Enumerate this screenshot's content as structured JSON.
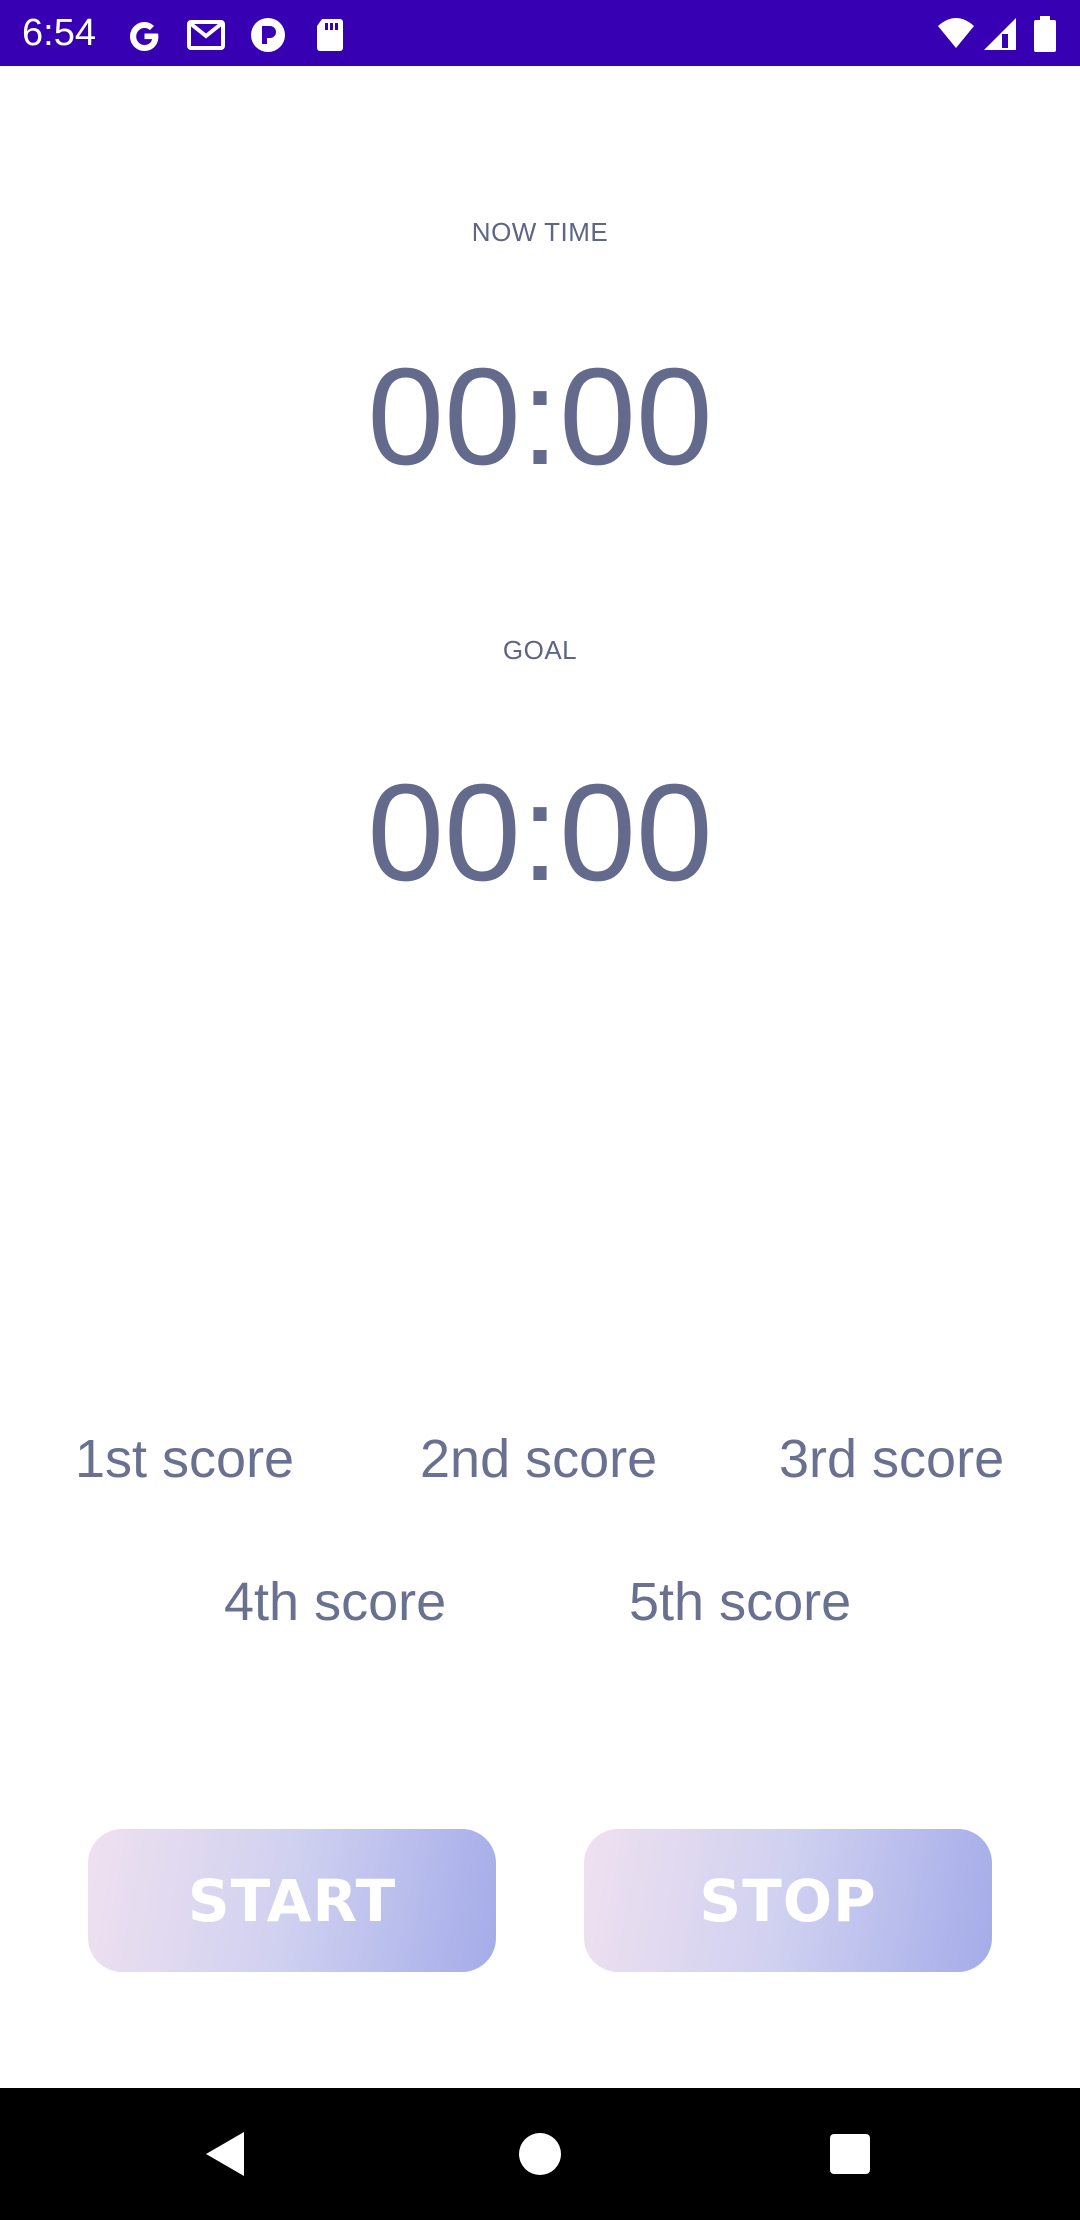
{
  "status_bar": {
    "time": "6:54",
    "icons": [
      "google-icon",
      "gmail-icon",
      "app-notification-icon",
      "sd-card-icon",
      "wifi-icon",
      "cellular-signal-icon",
      "battery-icon"
    ],
    "background_color": "#3700b3"
  },
  "timer": {
    "now_label": "NOW TIME",
    "now_value": "00:00",
    "goal_label": "GOAL",
    "goal_value": "00:00"
  },
  "scores": {
    "first": "1st score",
    "second": "2nd score",
    "third": "3rd score",
    "fourth": "4th score",
    "fifth": "5th score"
  },
  "buttons": {
    "start_label": "START",
    "stop_label": "STOP"
  },
  "nav_bar": {
    "icons": [
      "back-icon",
      "home-icon",
      "recents-icon"
    ]
  },
  "colors": {
    "text_primary": "#636a8b",
    "button_gradient_start": "#efe1f0",
    "button_gradient_end": "#a4ace9"
  }
}
